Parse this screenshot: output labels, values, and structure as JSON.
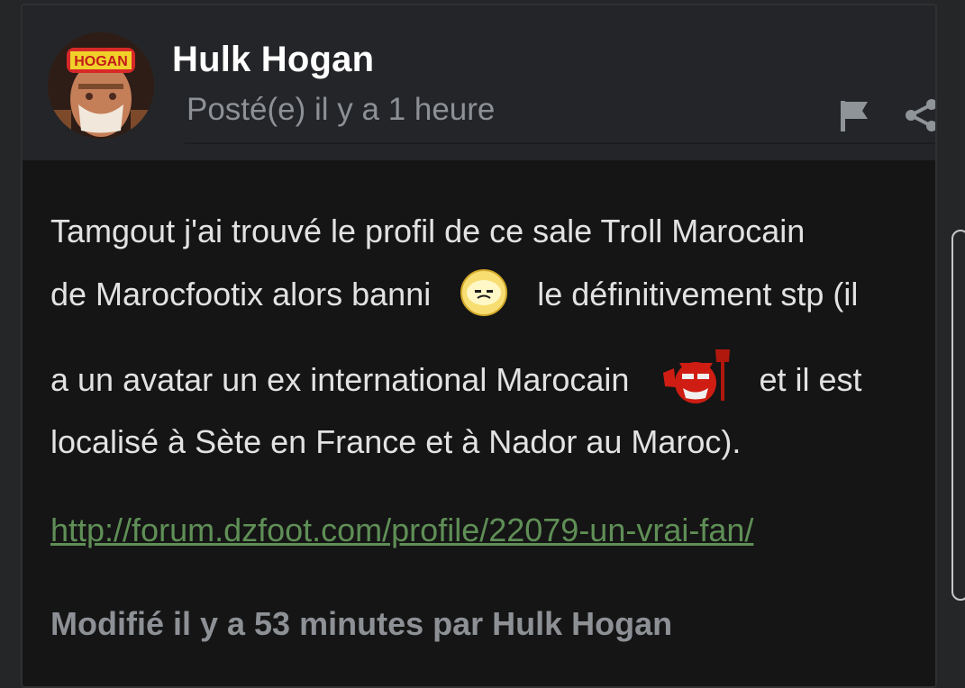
{
  "post": {
    "author": "Hulk Hogan",
    "posted": "Posté(e) il y a 1 heure",
    "avatar_text": "HOGAN",
    "line1": "Tamgout j'ai trouvé le profil de ce sale Troll Marocain",
    "line2_a": "de Marocfootix alors banni",
    "line2_b": "le définitivement stp (il",
    "line3_a": "a un avatar un ex international Marocain",
    "line3_b": "et il est",
    "line4": "localisé à Sète en France et à Nador au Maroc).",
    "link": "http://forum.dzfoot.com/profile/22079-un-vrai-fan/",
    "edited": "Modifié il y a 53 minutes par Hulk Hogan",
    "emoji1": "annoyed-face-emoji",
    "emoji2": "red-devil-emoji"
  },
  "colors": {
    "background": "#252628",
    "header": "#242528",
    "body": "#151515",
    "link": "#5f8f56",
    "muted": "#8d9196"
  }
}
